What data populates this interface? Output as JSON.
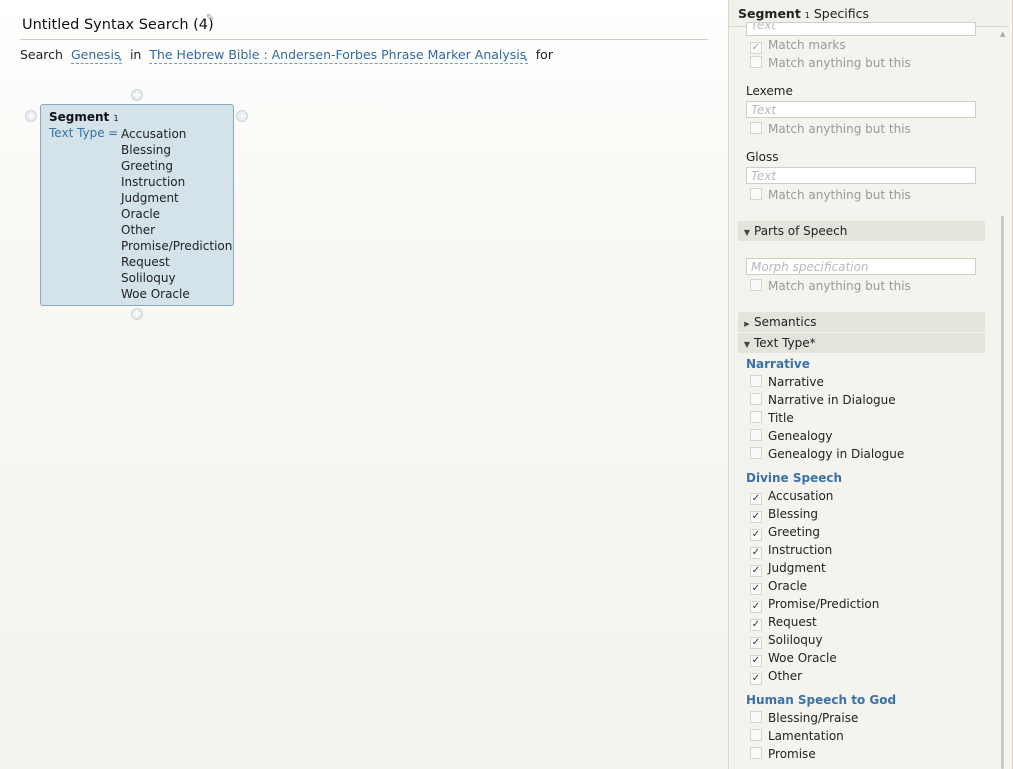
{
  "search": {
    "title": "Untitled Syntax Search (4)",
    "word_search": "Search",
    "scope": "Genesis",
    "word_in": "in",
    "resource": "The Hebrew Bible : Andersen-Forbes Phrase Marker Analysis",
    "word_for": "for"
  },
  "segment": {
    "title": "Segment",
    "subscript": "1",
    "attr": "Text Type",
    "eq": "=",
    "values": [
      "Accusation",
      "Blessing",
      "Greeting",
      "Instruction",
      "Judgment",
      "Oracle",
      "Other",
      "Promise/Prediction",
      "Request",
      "Soliloquy",
      "Woe Oracle"
    ]
  },
  "panel": {
    "title_bold": "Segment",
    "title_sub": "1",
    "title_rest": "Specifics",
    "clipped_text_placeholder": "Text",
    "match_marks": "Match marks",
    "match_anything_1": "Match anything but this",
    "lexeme_label": "Lexeme",
    "lexeme_placeholder": "Text",
    "match_anything_2": "Match anything but this",
    "gloss_label": "Gloss",
    "gloss_placeholder": "Text",
    "match_anything_3": "Match anything but this",
    "pos_header": "Parts of Speech",
    "morph_placeholder": "Morph specification",
    "match_anything_4": "Match anything but this",
    "semantics_header": "Semantics",
    "texttype_header": "Text Type*",
    "narrative_group": "Narrative",
    "narrative_items": [
      "Narrative",
      "Narrative in Dialogue",
      "Title",
      "Genealogy",
      "Genealogy in Dialogue"
    ],
    "divine_group": "Divine Speech",
    "divine_items": [
      "Accusation",
      "Blessing",
      "Greeting",
      "Instruction",
      "Judgment",
      "Oracle",
      "Promise/Prediction",
      "Request",
      "Soliloquy",
      "Woe Oracle",
      "Other"
    ],
    "human_group": "Human Speech to God",
    "human_items": [
      "Blessing/Praise",
      "Lamentation",
      "Promise"
    ]
  },
  "icons": {
    "plus": "+",
    "check": "✓",
    "tri_down": "▼",
    "tri_right": "▶",
    "edit": "✎",
    "scroll_up": "▲",
    "dd": "▾"
  }
}
